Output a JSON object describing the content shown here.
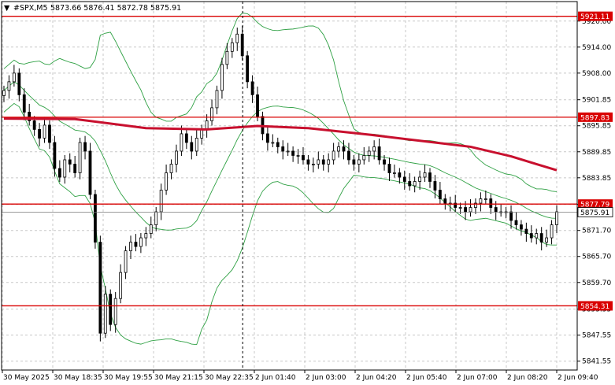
{
  "header": {
    "arrow": "▼",
    "symbol": "#SPX,M5",
    "ohlc": "5873.66 5876.41 5872.78 5875.91"
  },
  "colors": {
    "level_line": "#d90000",
    "level_tag_bg": "#d90000",
    "ma": "#c8102e",
    "bands": "#2ea043",
    "candle": "#000000",
    "grid": "#c8c8c8",
    "price_tag_bg": "#ffffff"
  },
  "chart_data": {
    "type": "candlestick",
    "title": "#SPX,M5",
    "ylim": [
      5839.5,
      5924.5
    ],
    "y_ticks": [
      "5920.00",
      "5914.00",
      "5908.00",
      "5901.85",
      "5895.85",
      "5889.85",
      "5883.85",
      "5877.70",
      "5871.70",
      "5865.70",
      "5859.70",
      "5853.55",
      "5847.55",
      "5841.55"
    ],
    "x_ticks": [
      "30 May 2025",
      "30 May 18:35",
      "30 May 19:55",
      "30 May 21:15",
      "30 May 22:35",
      "2 Jun 01:40",
      "2 Jun 03:00",
      "2 Jun 04:20",
      "2 Jun 05:40",
      "2 Jun 07:00",
      "2 Jun 08:20",
      "2 Jun 09:40"
    ],
    "levels": [
      {
        "label": "5921.11",
        "value": 5921.11
      },
      {
        "label": "5897.83",
        "value": 5897.83
      },
      {
        "label": "5877.79",
        "value": 5877.79
      },
      {
        "label": "5854.31",
        "value": 5854.31
      }
    ],
    "current_price": {
      "label": "5875.91",
      "value": 5875.91
    },
    "session_break_index": 47,
    "series_close": [
      5904,
      5906,
      5908,
      5903,
      5899,
      5897,
      5895,
      5893,
      5896,
      5892,
      5886,
      5884,
      5888,
      5887,
      5885,
      5892,
      5890,
      5880,
      5869,
      5848,
      5857,
      5850,
      5856,
      5862,
      5867,
      5869,
      5868,
      5870,
      5871,
      5873,
      5876,
      5881,
      5885,
      5887,
      5890,
      5894,
      5892,
      5890,
      5893,
      5895,
      5897,
      5900,
      5904,
      5910,
      5913,
      5915,
      5917,
      5912,
      5906,
      5903,
      5898,
      5894,
      5892,
      5892,
      5891,
      5890,
      5890,
      5889,
      5889,
      5888,
      5887,
      5887,
      5888,
      5887,
      5888,
      5890,
      5891,
      5890,
      5888,
      5887,
      5888,
      5889,
      5890,
      5891,
      5888,
      5887,
      5885,
      5885,
      5884,
      5883,
      5882,
      5883,
      5884,
      5885,
      5883,
      5881,
      5879,
      5878,
      5878,
      5877,
      5877,
      5876,
      5877,
      5878,
      5879,
      5879,
      5877,
      5876,
      5876,
      5876,
      5874,
      5873,
      5872,
      5871,
      5870,
      5871,
      5869,
      5870,
      5873,
      5876
    ],
    "moving_average": [
      [
        0,
        5897.5
      ],
      [
        14,
        5897.4
      ],
      [
        28,
        5895.3
      ],
      [
        40,
        5895.0
      ],
      [
        50,
        5895.8
      ],
      [
        60,
        5895.3
      ],
      [
        72,
        5893.8
      ],
      [
        82,
        5892.4
      ],
      [
        92,
        5891.0
      ],
      [
        100,
        5888.8
      ],
      [
        105,
        5887.0
      ],
      [
        109,
        5885.6
      ]
    ]
  }
}
